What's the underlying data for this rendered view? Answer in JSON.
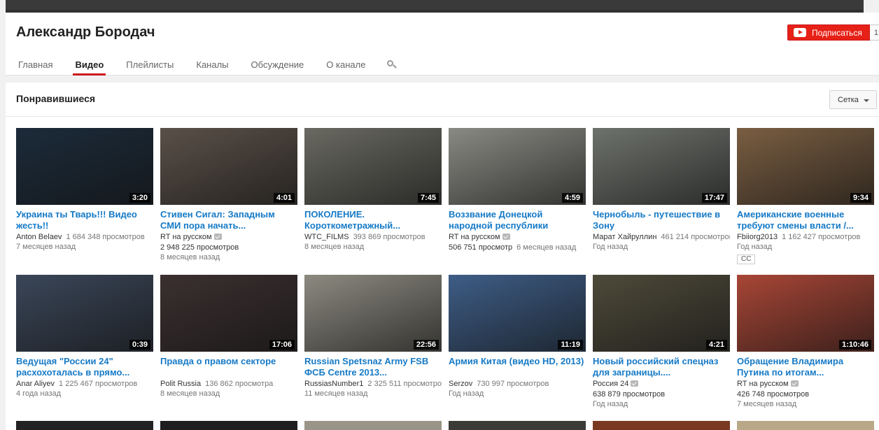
{
  "channel": {
    "name": "Александр Бородач",
    "subscribe_label": "Подписаться",
    "subscriber_count": "1"
  },
  "tabs": [
    {
      "label": "Главная",
      "active": false
    },
    {
      "label": "Видео",
      "active": true
    },
    {
      "label": "Плейлисты",
      "active": false
    },
    {
      "label": "Каналы",
      "active": false
    },
    {
      "label": "Обсуждение",
      "active": false
    },
    {
      "label": "О канале",
      "active": false
    }
  ],
  "section": {
    "title": "Понравившиеся",
    "view_label": "Сетка"
  },
  "videos": [
    {
      "title": "Украина ты Тварь!!! Видео жесть!!",
      "channel": "Anton Belaev",
      "verified": false,
      "views": "1 684 348 просмотров",
      "age": "7 месяцев назад",
      "duration": "3:20",
      "thumb_color": "#1c2b3a"
    },
    {
      "title": "Стивен Сигал: Западным СМИ пора начать...",
      "channel": "RT на русском",
      "verified": true,
      "views": "2 948 225 просмотров",
      "age": "8 месяцев назад",
      "duration": "4:01",
      "thumb_color": "#5a5048"
    },
    {
      "title": "ПОКОЛЕНИЕ. Короткометражный...",
      "channel": "WTC_FILMS",
      "verified": false,
      "views": "393 869 просмотров",
      "age": "8 месяцев назад",
      "duration": "7:45",
      "thumb_color": "#6a6a62"
    },
    {
      "title": "Воззвание Донецкой народной республики",
      "channel": "",
      "verified": false,
      "views": "506 751 просмотр",
      "age": "6 месяцев назад",
      "duration": "4:59",
      "thumb_color": "#8a8a84",
      "channel_line": "RT на русском"
    },
    {
      "title": "Чернобыль - путешествие в Зону",
      "channel": "Марат Хайруллин",
      "verified": false,
      "views": "461 214 просмотров",
      "age": "Год назад",
      "duration": "17:47",
      "thumb_color": "#6e726c"
    },
    {
      "title": "Американские военные требуют смены власти /...",
      "channel": "Fbiiorg2013",
      "verified": false,
      "views": "1 162 427 просмотров",
      "age": "Год назад",
      "duration": "9:34",
      "thumb_color": "#7a5e42",
      "cc": "CC"
    },
    {
      "title": "Ведущая \"России 24\" расхохоталась в прямо...",
      "channel": "Anar Aliyev",
      "verified": false,
      "views": "1 225 467 просмотров",
      "age": "4 года назад",
      "duration": "0:39",
      "thumb_color": "#3a4658"
    },
    {
      "title": "Правда о правом секторе",
      "channel": "Polit Russia",
      "verified": false,
      "views": "136 862 просмотра",
      "age": "8 месяцев назад",
      "duration": "17:06",
      "thumb_color": "#3b3030"
    },
    {
      "title": "Russian Spetsnaz Army FSB ФСБ Centre 2013...",
      "channel": "RussiasNumber1",
      "verified": false,
      "views": "2 325 511 просмотров",
      "age": "11 месяцев назад",
      "duration": "22:56",
      "thumb_color": "#8c8a80"
    },
    {
      "title": "Армия Китая (видео HD, 2013)",
      "channel": "Serzov",
      "verified": false,
      "views": "730 997 просмотров",
      "age": "Год назад",
      "duration": "11:19",
      "thumb_color": "#3e5d86"
    },
    {
      "title": "Новый российский спецназ для заграницы....",
      "channel": "Россия 24",
      "verified": true,
      "views": "638 879 просмотров",
      "age": "Год назад",
      "duration": "4:21",
      "thumb_color": "#4e4a3a"
    },
    {
      "title": "Обращение Владимира Путина по итогам...",
      "channel": "RT на русском",
      "verified": true,
      "views": "426 748 просмотров",
      "age": "7 месяцев назад",
      "duration": "1:10:46",
      "thumb_color": "#a84636"
    }
  ],
  "row3_colors": [
    "#222222",
    "#1e1e1e",
    "#9a9488",
    "#3a3a36",
    "#7a3a22",
    "#b8a888"
  ]
}
